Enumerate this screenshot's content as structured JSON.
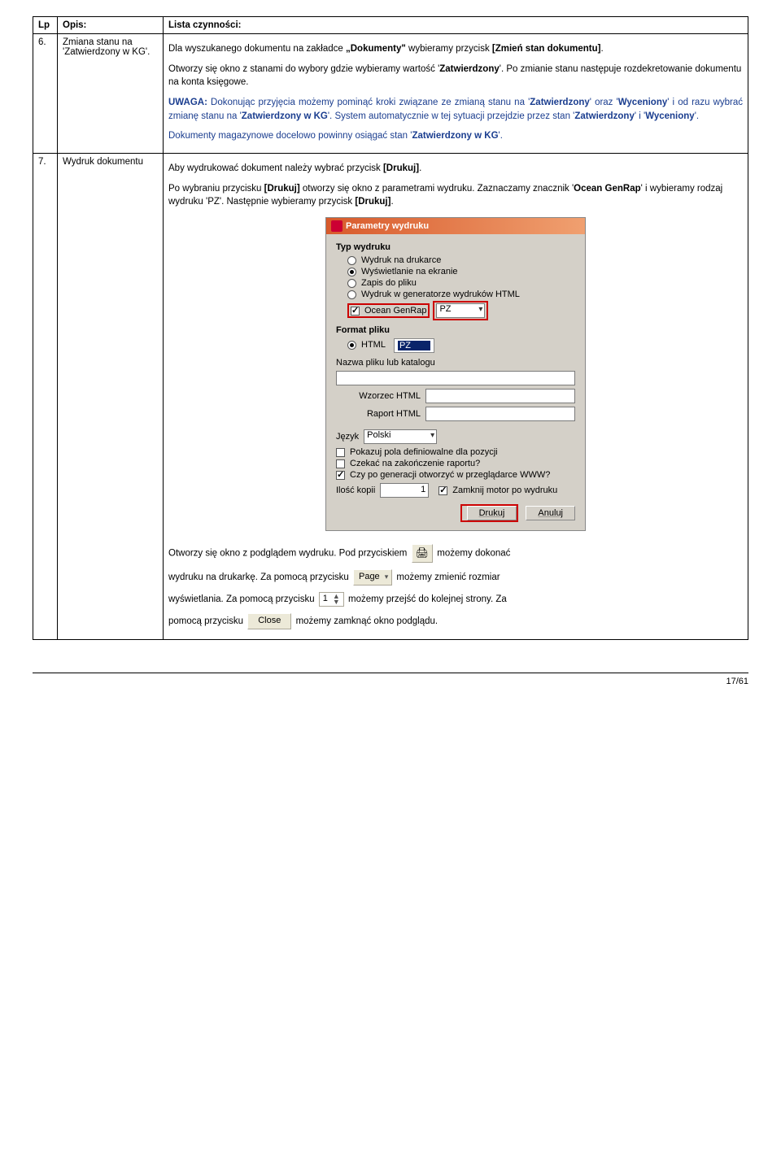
{
  "headers": {
    "lp": "Lp",
    "opis": "Opis:",
    "lista": "Lista czynności:"
  },
  "row6": {
    "lp": "6.",
    "opis": "Zmiana stanu na 'Zatwierdzony w KG'.",
    "p1a": "Dla wyszukanego dokumentu na zakładce ",
    "p1b": "„Dokumenty\"",
    "p1c": " wybieramy przycisk ",
    "p1d": "[Zmień stan dokumentu]",
    "p1e": ".",
    "p2a": "Otworzy się okno z stanami do wybory gdzie wybieramy wartość '",
    "p2b": "Zatwierdzony",
    "p2c": "'. Po zmianie stanu następuje rozdekretowanie dokumentu na konta księgowe.",
    "p3a": "UWAGA:",
    "p3b": " Dokonując przyjęcia możemy pominąć kroki związane ze zmianą stanu na '",
    "p3c": "Zatwierdzony",
    "p3d": "' oraz '",
    "p3e": "Wyceniony",
    "p3f": "' i od razu wybrać zmianę stanu na '",
    "p3g": "Zatwierdzony w KG",
    "p3h": "'. System automatycznie w tej sytuacji przejdzie przez stan '",
    "p3i": "Zatwierdzony",
    "p3j": "' i '",
    "p3k": "Wyceniony",
    "p3l": "'.",
    "p4a": "Dokumenty magazynowe docelowo powinny osiągać stan '",
    "p4b": "Zatwierdzony w KG",
    "p4c": "'."
  },
  "row7": {
    "lp": "7.",
    "opis": "Wydruk dokumentu",
    "p1a": "Aby wydrukować dokument należy wybrać przycisk ",
    "p1b": "[Drukuj]",
    "p1c": ".",
    "p2a": "Po wybraniu przycisku ",
    "p2b": "[Drukuj]",
    "p2c": " otworzy się okno z parametrami wydruku. Zaznaczamy znacznik '",
    "p2d": "Ocean GenRap",
    "p2e": "' i wybieramy rodzaj wydruku 'PZ'. Następnie wybieramy przycisk ",
    "p2f": "[Drukuj]",
    "p2g": ".",
    "after1": "Otworzy się okno z podglądem wydruku. Pod przyciskiem ",
    "after1b": " możemy dokonać",
    "after2a": "wydruku na drukarkę. Za pomocą przycisku ",
    "after2b": " możemy zmienić rozmiar",
    "after3a": "wyświetlania. Za pomocą przycisku ",
    "after3b": " możemy przejść do kolejnej strony. Za",
    "after4a": "pomocą przycisku ",
    "after4b": " możemy zamknąć okno podglądu."
  },
  "dialog": {
    "title": "Parametry wydruku",
    "group_typ": "Typ wydruku",
    "opt_drukarka": "Wydruk na drukarce",
    "opt_ekran": "Wyświetlanie na ekranie",
    "opt_plik": "Zapis do pliku",
    "opt_html": "Wydruk w generatorze wydruków HTML",
    "opt_genrap": "Ocean GenRap",
    "genrap_val": "PZ",
    "group_format": "Format pliku",
    "format_html": "HTML",
    "format_pz": "PZ",
    "lbl_nazwa": "Nazwa pliku lub katalogu",
    "lbl_wzorzec": "Wzorzec HTML",
    "lbl_raport": "Raport HTML",
    "lbl_jezyk": "Język",
    "jezyk_val": "Polski",
    "chk_pola": "Pokazuj pola definiowalne dla pozycji",
    "chk_czekac": "Czekać na zakończenie raportu?",
    "chk_www": "Czy po generacji otworzyć w przeglądarce WWW?",
    "lbl_kopii": "Ilość kopii",
    "kopii_val": "1",
    "chk_motor": "Zamknij motor po wydruku",
    "btn_drukuj": "Drukuj",
    "btn_anuluj": "Anuluj"
  },
  "inline": {
    "page_label": "Page",
    "num_val": "1",
    "close_label": "Close"
  },
  "footer": "17/61"
}
